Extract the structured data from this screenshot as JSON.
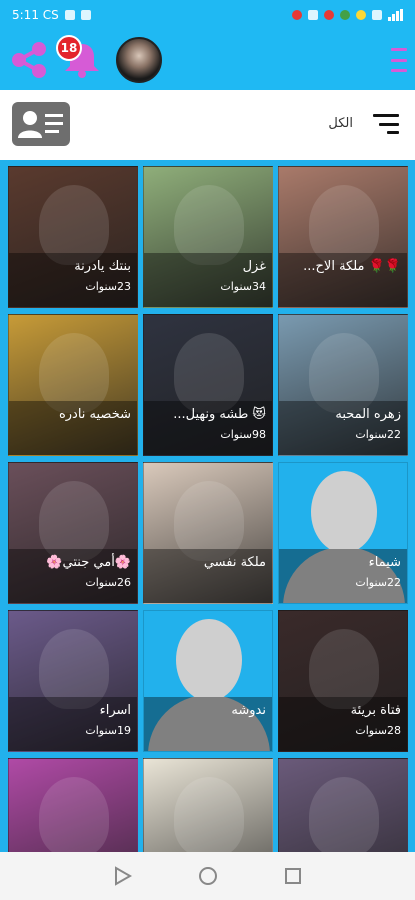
{
  "status_bar": {
    "time": "5:11 CS"
  },
  "app_bar": {
    "notification_count": "18",
    "accent_color": "#1fb9f3",
    "share_icon": "share-icon",
    "bell_icon": "bell-icon",
    "menu_icon": "menu-icon"
  },
  "filter_bar": {
    "label": "الكل",
    "contact_icon": "contact-card-icon",
    "filter_icon": "filter-icon"
  },
  "profiles": [
    {
      "name": "بنتك يادرنة",
      "age": "23سنوات",
      "bg": "#5a3a2e"
    },
    {
      "name": "غزل",
      "age": "34سنوات",
      "bg": "#8fae7a"
    },
    {
      "name": "🌹🌹 ملكة الاح...",
      "age": "",
      "bg": "#a97a6a"
    },
    {
      "name": "شخصيه نادره",
      "age": "",
      "bg": "#c79b38"
    },
    {
      "name": "😻 طشه ونهيل...",
      "age": "98سنوات",
      "bg": "#2f3340"
    },
    {
      "name": "زهره المحبه",
      "age": "22سنوات",
      "bg": "#7a9ab0"
    },
    {
      "name": "🌸أمي جنتي🌸",
      "age": "26سنوات",
      "bg": "#6a4f5a"
    },
    {
      "name": "ملكة نفسي",
      "age": "",
      "bg": "#d9c9bb"
    },
    {
      "name": "شيماء",
      "age": "22سنوات",
      "bg": "silhouette"
    },
    {
      "name": "اسراء",
      "age": "19سنوات",
      "bg": "#6b5a8a"
    },
    {
      "name": "ندوشه",
      "age": "",
      "bg": "silhouette"
    },
    {
      "name": "فتاة بريئة",
      "age": "28سنوات",
      "bg": "#3a2a2a"
    },
    {
      "name": "",
      "age": "",
      "bg": "#b04aa6"
    },
    {
      "name": "",
      "age": "",
      "bg": "#e9e4d6"
    },
    {
      "name": "",
      "age": "",
      "bg": "#6a5a7a"
    }
  ],
  "nav": {
    "back": "back-icon",
    "home": "home-icon",
    "recents": "recents-icon"
  }
}
